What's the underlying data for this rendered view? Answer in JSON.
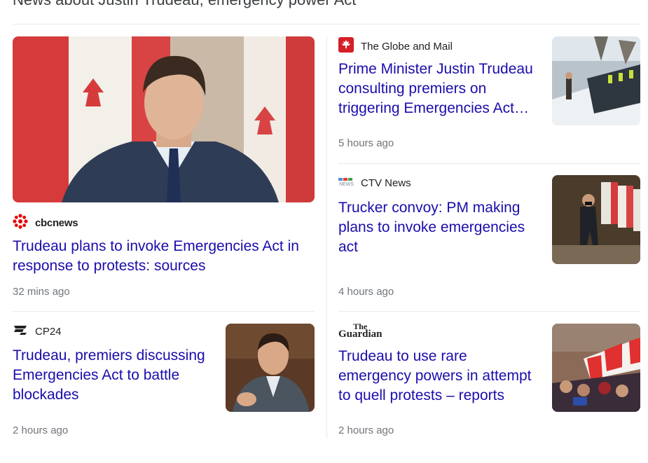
{
  "section": {
    "title": "News about Justin Trudeau, emergency power Act"
  },
  "colors": {
    "link": "#1a0dab",
    "meta": "#70757a",
    "globe_red": "#d42026",
    "cbc_red": "#e60505"
  },
  "stories": [
    {
      "source": "cbcnews",
      "source_logo": "cbc-gem-icon",
      "headline": "Trudeau plans to invoke Emergencies Act in response to protests: sources",
      "time": "32 mins ago",
      "image": "trudeau-in-front-of-canadian-flags"
    },
    {
      "source": "The Globe and Mail",
      "source_logo": "maple-leaf-icon",
      "headline": "Prime Minister Justin Trudeau consulting premiers on triggering Emergencies Act to...",
      "time": "5 hours ago",
      "image": "police-line-in-snow"
    },
    {
      "source": "CTV News",
      "source_logo": "ctv-news-icon",
      "headline": "Trucker convoy: PM making plans to invoke emergencies act",
      "time": "4 hours ago",
      "image": "pm-walking-past-flags"
    },
    {
      "source": "CP24",
      "source_logo": "cp24-icon",
      "headline": "Trudeau, premiers discussing Emergencies Act to battle blockades",
      "time": "2 hours ago",
      "image": "trudeau-speaking-in-parliament"
    },
    {
      "source": "The Guardian",
      "source_logo": "guardian-wordmark",
      "logo_text_top": "The",
      "logo_text_bottom": "Guardian",
      "headline": "Trudeau to use rare emergency powers in attempt to quell protests – reports",
      "time": "2 hours ago",
      "image": "protest-crowd-with-flag"
    }
  ]
}
